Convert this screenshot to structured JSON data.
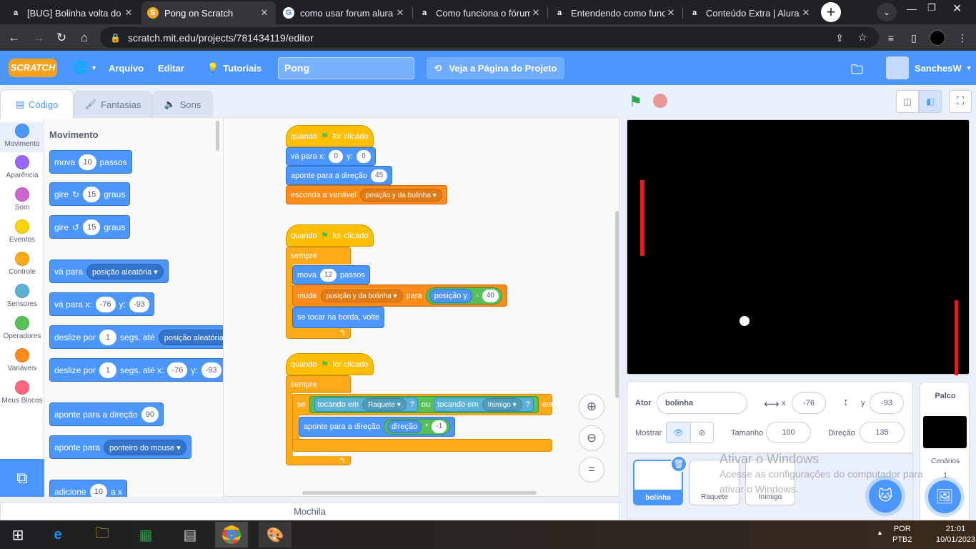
{
  "browser": {
    "tabs": [
      {
        "title": "[BUG] Bolinha volta do",
        "icon": "a"
      },
      {
        "title": "Pong on Scratch",
        "icon": "scratch"
      },
      {
        "title": "como usar forum alura",
        "icon": "google"
      },
      {
        "title": "Como funciona o fórum",
        "icon": "a"
      },
      {
        "title": "Entendendo como func",
        "icon": "a"
      },
      {
        "title": "Conteúdo Extra | Alura",
        "icon": "a"
      }
    ],
    "url": "scratch.mit.edu/projects/781434119/editor"
  },
  "menu": {
    "logo": "SCRATCH",
    "file": "Arquivo",
    "edit": "Editar",
    "tutorials": "Tutoriais",
    "project_title": "Pong",
    "see_project": "Veja a Página do Projeto",
    "user": "SanchesW"
  },
  "editor_tabs": {
    "code": "Código",
    "costumes": "Fantasias",
    "sounds": "Sons"
  },
  "categories": [
    {
      "label": "Movimento",
      "color": "#4c97ff"
    },
    {
      "label": "Aparência",
      "color": "#9966ff"
    },
    {
      "label": "Som",
      "color": "#cf63cf"
    },
    {
      "label": "Eventos",
      "color": "#ffd500"
    },
    {
      "label": "Controle",
      "color": "#ffab19"
    },
    {
      "label": "Sensores",
      "color": "#5cb1d6"
    },
    {
      "label": "Operadores",
      "color": "#59c059"
    },
    {
      "label": "Variáveis",
      "color": "#ff8c1a"
    },
    {
      "label": "Meus Blocos",
      "color": "#ff6680"
    }
  ],
  "palette": {
    "heading": "Movimento",
    "move": {
      "a": "mova",
      "v": "10",
      "b": "passos"
    },
    "turn_right": {
      "a": "gire",
      "v": "15",
      "b": "graus"
    },
    "turn_left": {
      "a": "gire",
      "v": "15",
      "b": "graus"
    },
    "goto": {
      "a": "vá para",
      "dd": "posição aleatória"
    },
    "goto_xy": {
      "a": "vá para x:",
      "x": "-76",
      "yl": "y:",
      "y": "-93"
    },
    "glide": {
      "a": "deslize por",
      "v": "1",
      "b": "segs. até",
      "dd": "posição aleatória"
    },
    "glide_xy": {
      "a": "deslize por",
      "v": "1",
      "b": "segs. até x:",
      "x": "-76",
      "yl": "y:",
      "y": "-93"
    },
    "point_dir": {
      "a": "aponte para a direção",
      "v": "90"
    },
    "point_to": {
      "a": "aponte para",
      "dd": "ponteiro do mouse"
    },
    "change_x": {
      "a": "adicione",
      "v": "10",
      "b": "a x"
    }
  },
  "scripts": {
    "s1": {
      "when": "quando",
      "clicked": "for clicado",
      "goto": "vá para x:",
      "x": "0",
      "yl": "y:",
      "y": "0",
      "point": "aponte para a direção",
      "dir": "45",
      "hide": "esconda a variável",
      "var": "posição y da bolinha"
    },
    "s2": {
      "when": "quando",
      "clicked": "for clicado",
      "forever": "sempre",
      "move": "mova",
      "steps": "12",
      "passos": "passos",
      "set": "mude",
      "var": "posição y da bolinha",
      "para": "para",
      "posy": "posição y",
      "minus": "-",
      "val": "40",
      "bounce": "se tocar na borda, volte"
    },
    "s3": {
      "when": "quando",
      "clicked": "for clicado",
      "forever": "sempre",
      "if": "se",
      "touching": "tocando em",
      "t1": "Raquete",
      "q": "?",
      "or": "ou",
      "t2": "Inimigo",
      "then": "então",
      "point": "aponte para a direção",
      "dir": "direção",
      "times": "*",
      "neg": "-1"
    }
  },
  "sprite": {
    "actor_label": "Ator",
    "name": "bolinha",
    "x_label": "x",
    "x": "-76",
    "y_label": "y",
    "y": "-93",
    "show_label": "Mostrar",
    "size_label": "Tamanho",
    "size": "100",
    "dir_label": "Direção",
    "dir": "135"
  },
  "sprites": [
    {
      "name": "bolinha"
    },
    {
      "name": "Raquete"
    },
    {
      "name": "Inimigo"
    }
  ],
  "stage_panel": {
    "title": "Palco",
    "backdrops": "Cenários",
    "count": "1"
  },
  "backpack": "Mochila",
  "watermark": {
    "line1": "Ativar o Windows",
    "line2": "Acesse as configurações do computador para",
    "line3": "ativar o Windows."
  },
  "taskbar": {
    "lang1": "POR",
    "lang2": "PTB2",
    "time": "21:01",
    "date": "10/01/2023"
  }
}
